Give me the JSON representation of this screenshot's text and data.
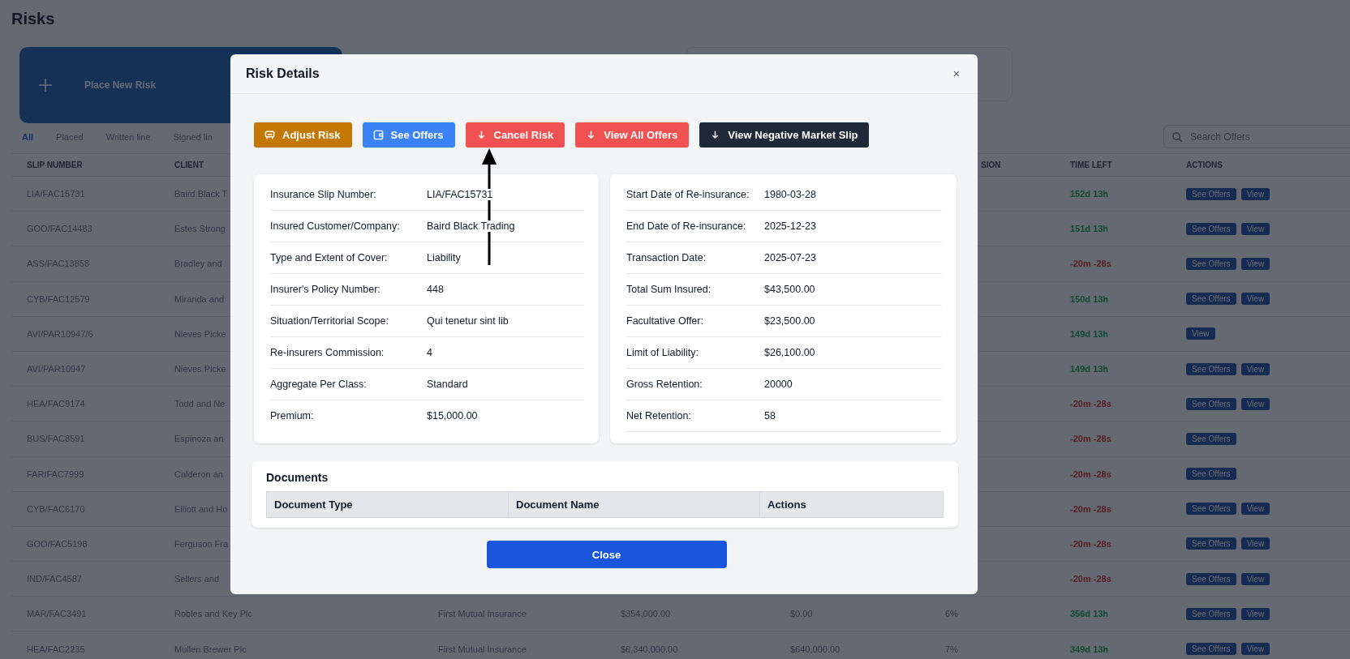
{
  "page": {
    "title": "Risks"
  },
  "place_new_risk": {
    "label": "Place New Risk"
  },
  "tabs": [
    {
      "label": "All",
      "selected": true
    },
    {
      "label": "Placed",
      "selected": false
    },
    {
      "label": "Written line",
      "selected": false
    },
    {
      "label": "Signed lin",
      "selected": false
    }
  ],
  "search": {
    "placeholder": "Search Offers"
  },
  "table": {
    "header": {
      "slip_number": "SLIP NUMBER",
      "client": "CLIENT",
      "column_6": "SION",
      "time_left": "TIME LEFT",
      "actions": "ACTIONS"
    },
    "rows": [
      {
        "slip_number": "LIA/FAC15731",
        "client": "Baird Black T",
        "time_left": "152d 13h",
        "expired": false,
        "actions": [
          "See Offers",
          "View"
        ]
      },
      {
        "slip_number": "GOO/FAC14483",
        "client": "Estes Strong",
        "time_left": "151d 13h",
        "expired": false,
        "actions": [
          "See Offers",
          "View"
        ]
      },
      {
        "slip_number": "ASS/FAC13858",
        "client": "Bradley and",
        "time_left": "-20m -28s",
        "expired": true,
        "actions": [
          "See Offers",
          "View"
        ]
      },
      {
        "slip_number": "CYB/FAC12579",
        "client": "Miranda and",
        "time_left": "150d 13h",
        "expired": false,
        "actions": [
          "See Offers",
          "View"
        ]
      },
      {
        "slip_number": "AVI/PAR10947/6",
        "client": "Nieves Picke",
        "time_left": "149d 13h",
        "expired": false,
        "actions": [
          "View"
        ]
      },
      {
        "slip_number": "AVI/PAR10947",
        "client": "Nieves Picke",
        "time_left": "149d 13h",
        "expired": false,
        "actions": [
          "See Offers",
          "View"
        ]
      },
      {
        "slip_number": "HEA/FAC9174",
        "client": "Todd and Ne",
        "time_left": "-20m -28s",
        "expired": true,
        "actions": [
          "See Offers",
          "View"
        ]
      },
      {
        "slip_number": "BUS/FAC8591",
        "client": "Espinoza an",
        "time_left": "-20m -28s",
        "expired": true,
        "actions": [
          "See Offers"
        ]
      },
      {
        "slip_number": "FAR/FAC7999",
        "client": "Calderon an",
        "time_left": "-20m -28s",
        "expired": true,
        "actions": [
          "See Offers"
        ]
      },
      {
        "slip_number": "CYB/FAC6170",
        "client": "Elliott and Ho",
        "time_left": "-20m -28s",
        "expired": true,
        "actions": [
          "See Offers",
          "View"
        ]
      },
      {
        "slip_number": "GOO/FAC5198",
        "client": "Ferguson Fra",
        "time_left": "-20m -28s",
        "expired": true,
        "actions": [
          "See Offers",
          "View"
        ]
      },
      {
        "slip_number": "IND/FAC4587",
        "client": "Sellers and",
        "time_left": "-20m -28s",
        "expired": true,
        "actions": [
          "See Offers",
          "View"
        ]
      },
      {
        "slip_number": "MAR/FAC3491",
        "client": "Robles and Key Plc",
        "column_3": "First Mutual Insurance",
        "column_4": "$354,000.00",
        "column_5": "$0.00",
        "column_6": "6%",
        "time_left": "356d 13h",
        "expired": false,
        "actions": [
          "See Offers",
          "View"
        ]
      },
      {
        "slip_number": "HEA/FAC2235",
        "client": "Mullen Brewer Plc",
        "column_3": "First Mutual Insurance",
        "column_4": "$6,340,000.00",
        "column_5": "$640,000.00",
        "column_6": "7%",
        "time_left": "349d 13h",
        "expired": false,
        "actions": [
          "See Offers",
          "View"
        ]
      }
    ]
  },
  "modal": {
    "title": "Risk Details",
    "close": "×",
    "actions": [
      {
        "label": "Adjust Risk",
        "kind": "warning"
      },
      {
        "label": "See Offers",
        "kind": "primary"
      },
      {
        "label": "Cancel Risk",
        "kind": "danger"
      },
      {
        "label": "View All Offers",
        "kind": "danger"
      },
      {
        "label": "View Negative Market Slip",
        "kind": "dark"
      }
    ],
    "details_left": [
      {
        "label": "Insurance Slip Number:",
        "value": "LIA/FAC15731"
      },
      {
        "label": "Insured Customer/Company:",
        "value": "Baird Black Trading"
      },
      {
        "label": "Type and Extent of Cover:",
        "value": "Liability"
      },
      {
        "label": "Insurer's Policy Number:",
        "value": "448"
      },
      {
        "label": "Situation/Territorial Scope:",
        "value": "Qui tenetur sint lib"
      },
      {
        "label": "Re-insurers Commission:",
        "value": "4"
      },
      {
        "label": "Aggregate Per Class:",
        "value": "Standard"
      },
      {
        "label": "Premium:",
        "value": "$15,000.00"
      }
    ],
    "details_right": [
      {
        "label": "Start Date of Re-insurance:",
        "value": "1980-03-28"
      },
      {
        "label": "End Date of Re-insurance:",
        "value": "2025-12-23"
      },
      {
        "label": "Transaction Date:",
        "value": "2025-07-23"
      },
      {
        "label": "Total Sum Insured:",
        "value": "$43,500.00"
      },
      {
        "label": "Facultative Offer:",
        "value": "$23,500.00"
      },
      {
        "label": "Limit of Liability:",
        "value": "$26,100.00"
      },
      {
        "label": "Gross Retention:",
        "value": "20000"
      },
      {
        "label": "Net Retention:",
        "value": "58"
      }
    ],
    "documents": {
      "title": "Documents",
      "columns": [
        "Document Type",
        "Document Name",
        "Actions"
      ]
    },
    "close_button": "Close"
  }
}
